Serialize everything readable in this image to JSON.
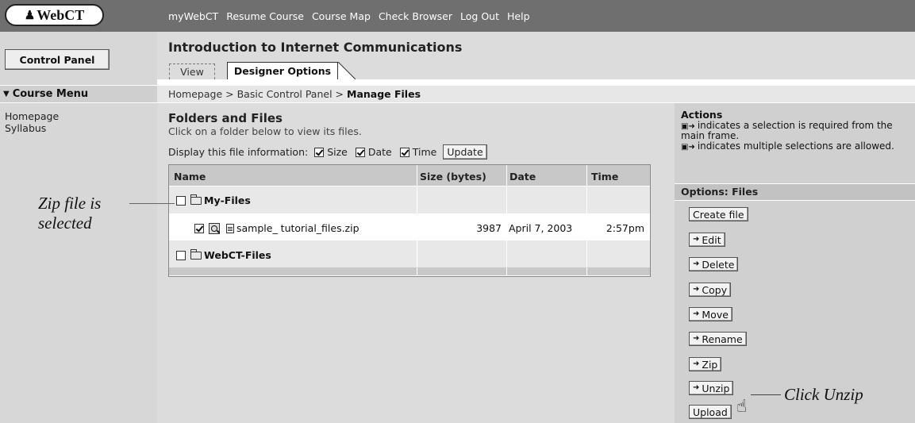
{
  "logo": {
    "text": "WebCT"
  },
  "topnav": [
    "myWebCT",
    "Resume Course",
    "Course Map",
    "Check Browser",
    "Log Out",
    "Help"
  ],
  "control_panel_label": "Control Panel",
  "course_title": "Introduction to Internet Communications",
  "tabs": [
    "View",
    "Designer Options"
  ],
  "course_menu": {
    "label": "Course Menu",
    "items": [
      "Homepage",
      "Syllabus"
    ]
  },
  "breadcrumb": {
    "parts": [
      "Homepage",
      "Basic Control Panel"
    ],
    "separator": ">",
    "current": "Manage Files"
  },
  "files": {
    "title": "Folders and Files",
    "subtitle": "Click on a folder below to view its files.",
    "display_label": "Display this file information:",
    "options": [
      {
        "label": "Size",
        "checked": true
      },
      {
        "label": "Date",
        "checked": true
      },
      {
        "label": "Time",
        "checked": true
      }
    ],
    "update_label": "Update",
    "columns": [
      "Name",
      "Size (bytes)",
      "Date",
      "Time"
    ],
    "rows": [
      {
        "name": "My-Files",
        "type": "folder",
        "checked": false,
        "size": "",
        "date": "",
        "time": ""
      },
      {
        "name": "sample_ tutorial_files.zip",
        "type": "file",
        "checked": true,
        "size": "3987",
        "date": "April 7, 2003",
        "time": "2:57pm"
      },
      {
        "name": "WebCT-Files",
        "type": "folder",
        "checked": false,
        "size": "",
        "date": "",
        "time": ""
      }
    ]
  },
  "actions": {
    "title": "Actions",
    "note1": "indicates a selection is required from the main frame.",
    "note2": "indicates multiple selections are allowed.",
    "options_label": "Options: Files",
    "buttons": [
      "Create file",
      "Edit",
      "Delete",
      "Copy",
      "Move",
      "Rename",
      "Zip",
      "Unzip",
      "Upload"
    ]
  },
  "annotations": {
    "zip_selected_line1": "Zip file is",
    "zip_selected_line2": "selected",
    "click_unzip": "Click Unzip"
  },
  "colors": {
    "topbar": "#6f6f6f",
    "main_bg": "#dcdcdc",
    "right_bg": "#d0d0d0"
  }
}
